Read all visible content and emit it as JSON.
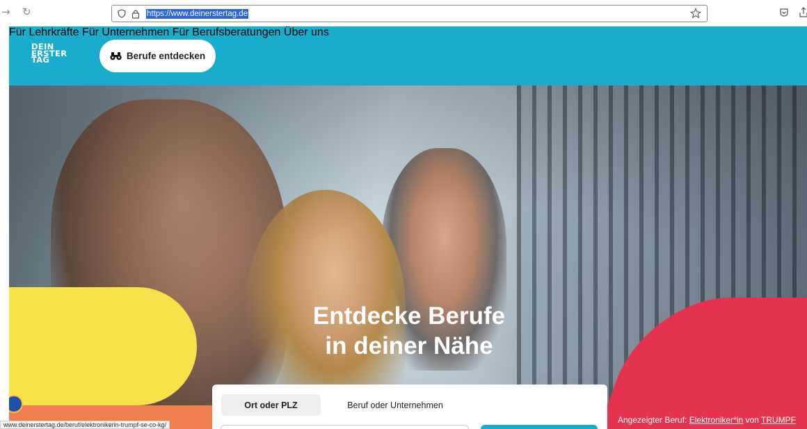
{
  "browser": {
    "back_glyph": "→",
    "reload_glyph": "↻",
    "url": "https://www.deinerstertag.de",
    "status_url": "www.deinerstertag.de/beruf/elektronikerin-trumpf-se-co-kg/"
  },
  "header": {
    "background_color": "#1aaccc",
    "logo_lines": [
      "DEIN",
      "ERSTER",
      "TAG"
    ],
    "explore_button": "Berufe entdecken",
    "nav": [
      "Für Lehrkräfte",
      "Für Unternehmen",
      "Für Berufsberatungen",
      "Über uns"
    ]
  },
  "hero": {
    "title_line1": "Entdecke Berufe",
    "title_line2": "in deiner Nähe",
    "accent_yellow": "#f7e24a",
    "accent_red": "#e3334f",
    "accent_orange": "#ef7f4f"
  },
  "search": {
    "tabs": [
      "Ort oder PLZ",
      "Beruf oder Unternehmen"
    ],
    "active_tab": "Ort oder PLZ"
  },
  "info": {
    "prefix": "Angezeigter Beruf: ",
    "job_link": "Elektroniker*in",
    "middle": " von ",
    "company_link": "TRUMPF"
  }
}
